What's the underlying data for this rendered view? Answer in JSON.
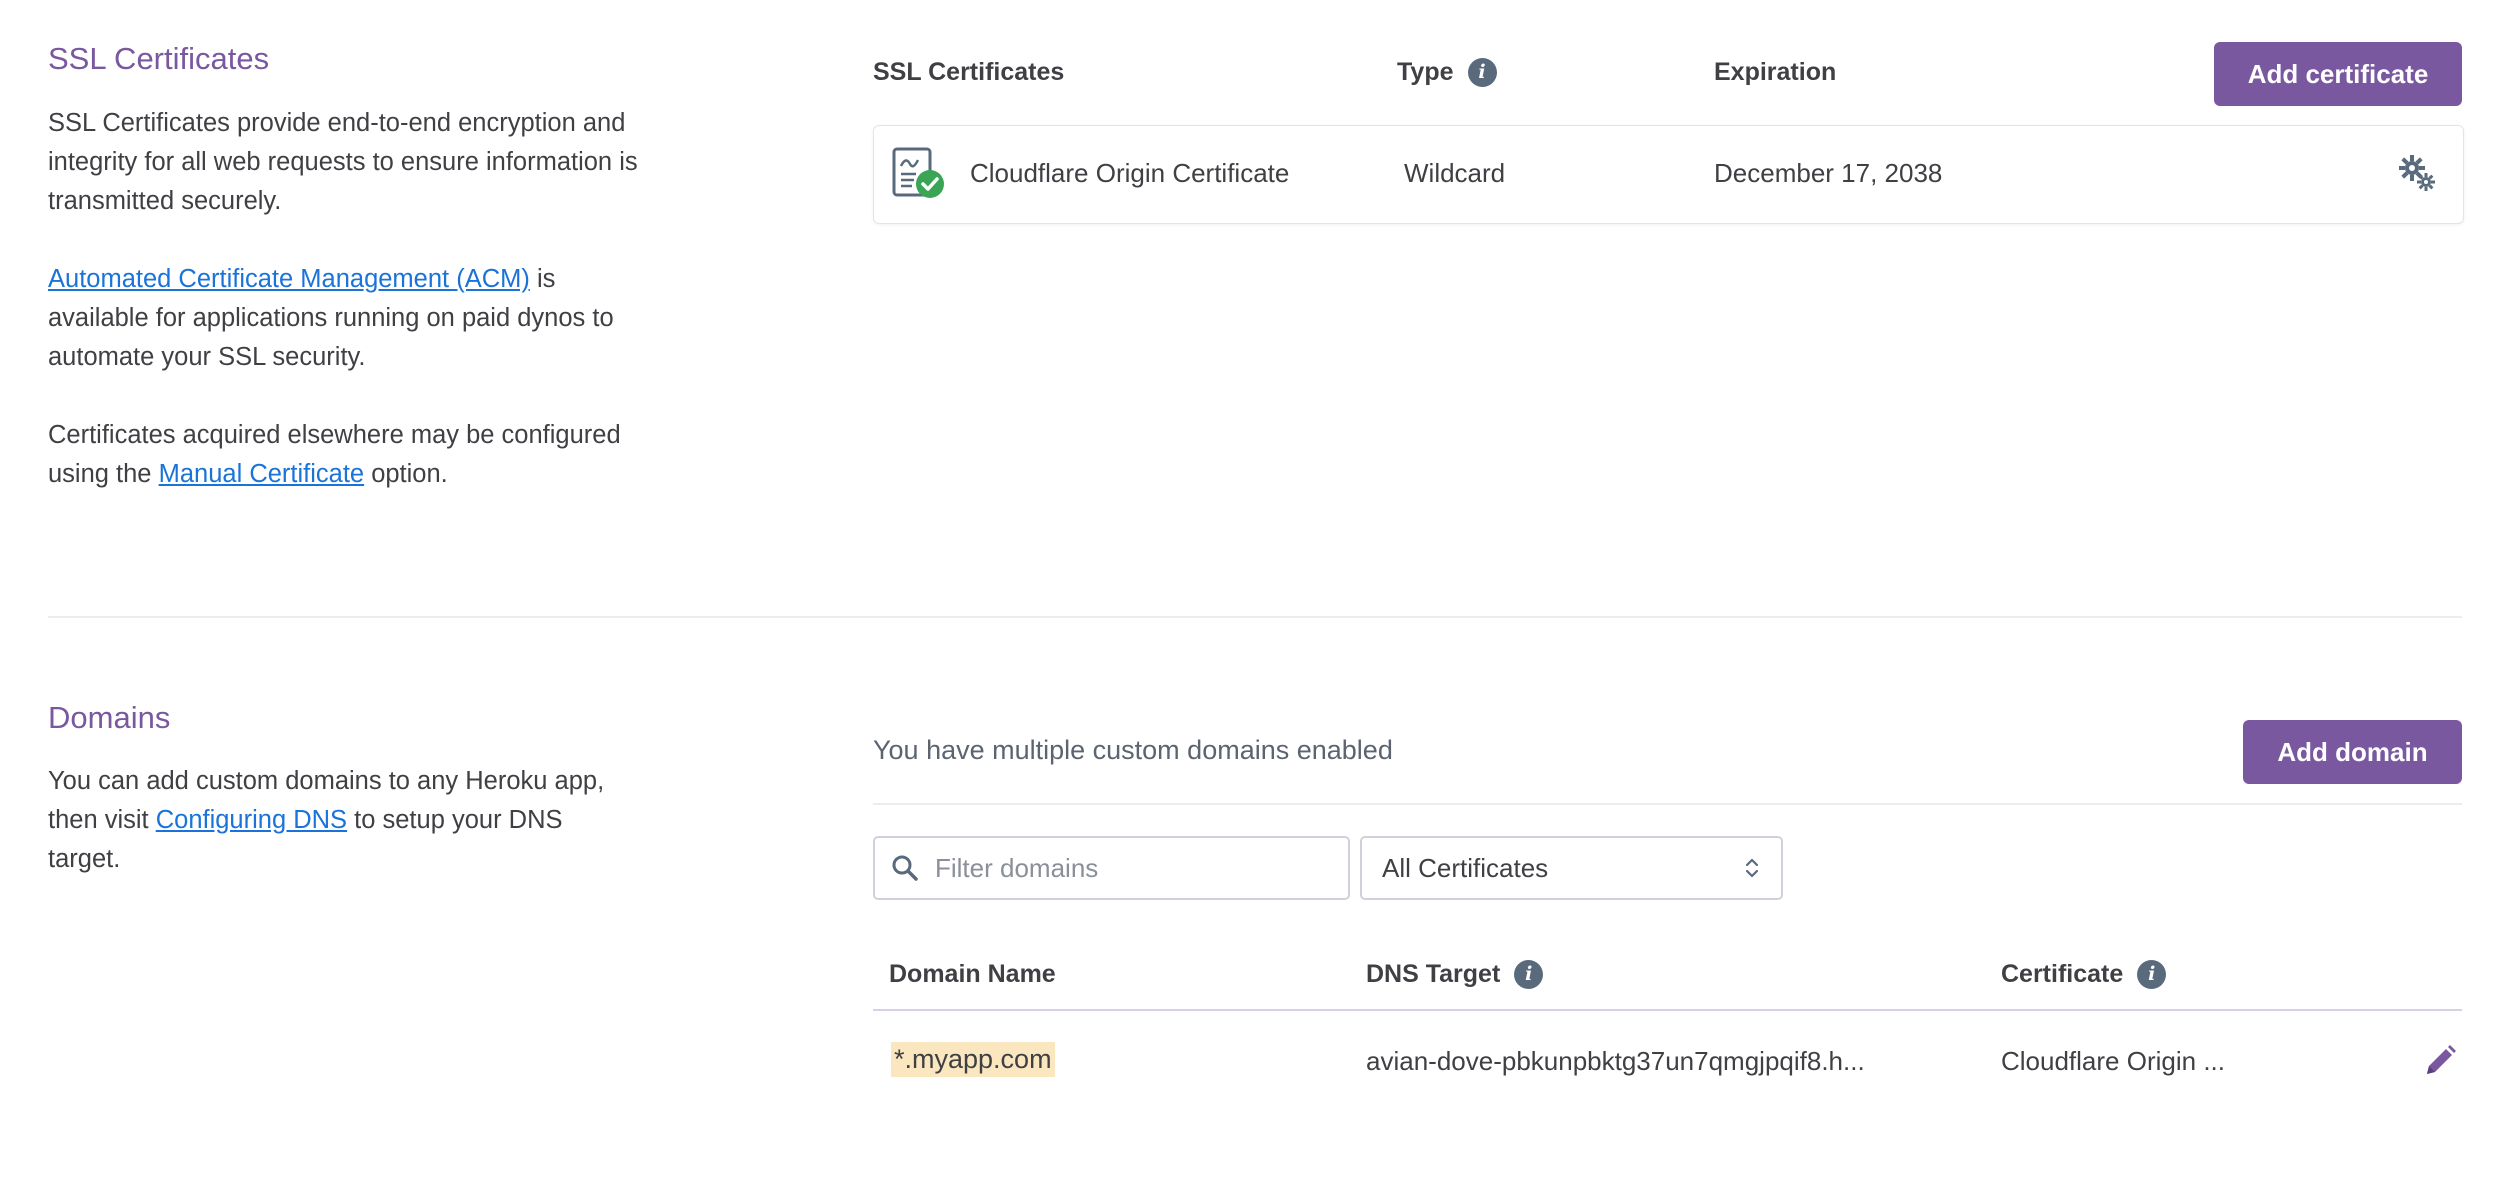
{
  "ssl": {
    "title": "SSL Certificates",
    "desc_p1": "SSL Certificates provide end-to-end encryption and integrity for all web requests to ensure information is transmitted securely.",
    "acm_link": "Automated Certificate Management (ACM)",
    "desc_p2_rest": " is available for applications running on paid dynos to automate your SSL security.",
    "desc_p3_pre": "Certificates acquired elsewhere may be configured using the ",
    "manual_link": "Manual Certificate",
    "desc_p3_post": " option.",
    "columns": {
      "name": "SSL Certificates",
      "type": "Type",
      "expiration": "Expiration"
    },
    "add_button": "Add certificate",
    "certificates": [
      {
        "name": "Cloudflare Origin Certificate",
        "type": "Wildcard",
        "expiration": "December 17, 2038"
      }
    ]
  },
  "domains": {
    "title": "Domains",
    "desc_pre": "You can add custom domains to any Heroku app, then visit ",
    "dns_link": "Configuring DNS",
    "desc_post": " to setup your DNS target.",
    "status_text": "You have multiple custom domains enabled",
    "add_button": "Add domain",
    "filter_placeholder": "Filter domains",
    "certificate_filter": "All Certificates",
    "columns": {
      "domain": "Domain Name",
      "dns": "DNS Target",
      "certificate": "Certificate"
    },
    "rows": [
      {
        "domain": "*.myapp.com",
        "dns_target": "avian-dove-pbkunpbktg37un7qmgjpqif8.h...",
        "certificate": "Cloudflare Origin ..."
      }
    ]
  },
  "icons": {
    "info": "info-icon",
    "certificate": "certificate-verified-icon",
    "settings": "gears-icon",
    "search": "search-icon",
    "select_arrows": "sort-arrows-icon",
    "edit": "pencil-icon"
  },
  "colors": {
    "brand": "#79589f",
    "link": "#1a73d9",
    "highlight": "#fbe7bf",
    "verified": "#3aa655"
  }
}
